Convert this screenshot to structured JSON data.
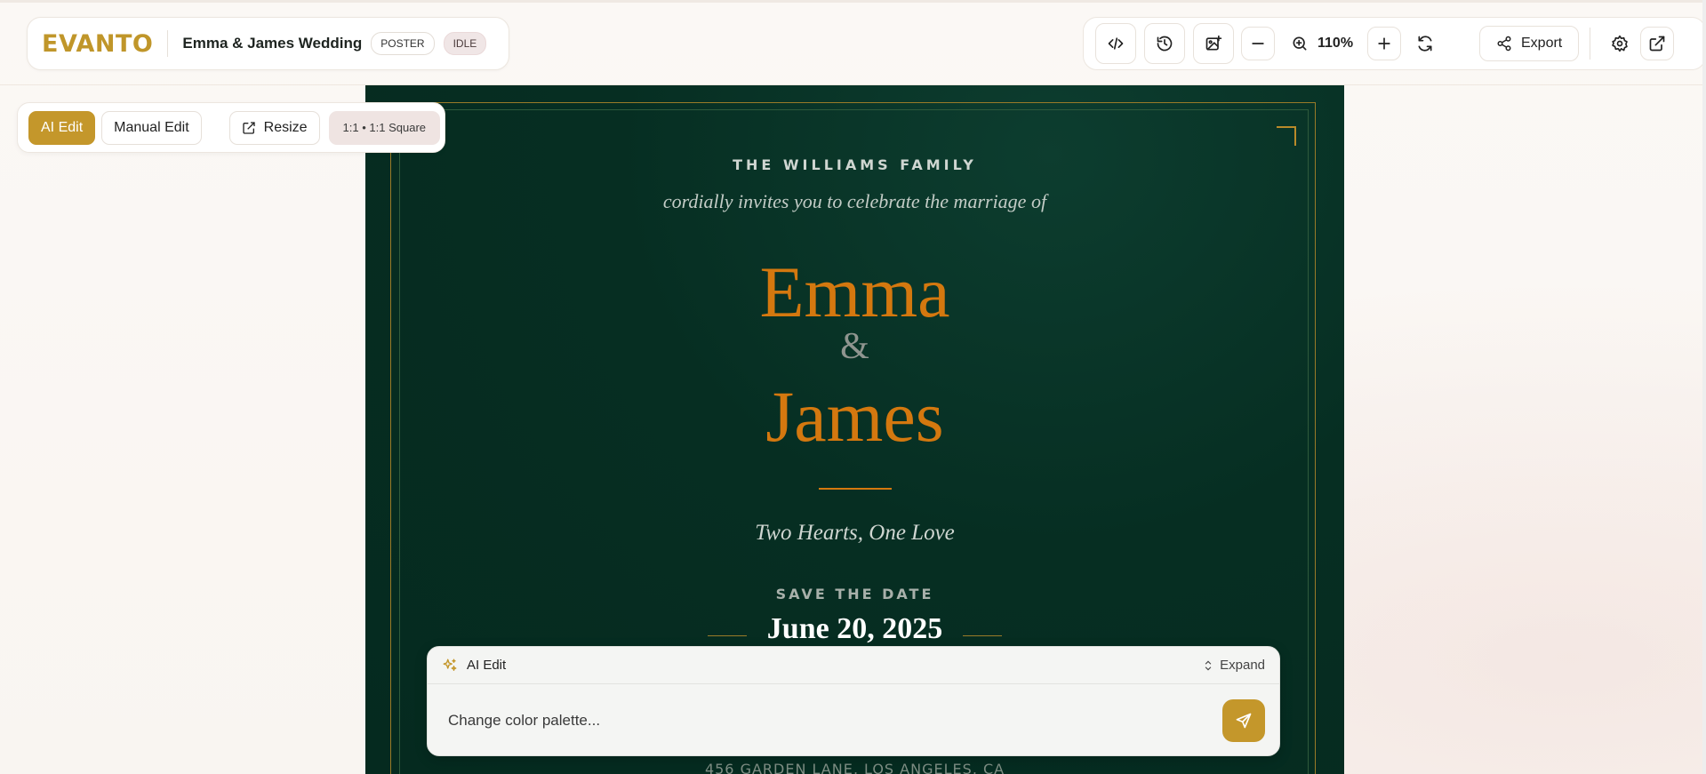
{
  "app": {
    "logo": "EVANTO",
    "project_title": "Emma & James Wedding",
    "type_badge": "POSTER",
    "status_badge": "IDLE"
  },
  "toolbar": {
    "zoom_level": "110%",
    "export_label": "Export",
    "icons": [
      "code-icon",
      "history-icon",
      "image-add-icon",
      "zoom-out-icon",
      "zoom-in-icon",
      "zoom-plus-icon",
      "refresh-icon",
      "share-icon",
      "settings-icon",
      "external-link-icon"
    ]
  },
  "modes": {
    "ai_edit": "AI Edit",
    "manual_edit": "Manual Edit",
    "resize": "Resize",
    "ratio": "1:1 • 1:1 Square"
  },
  "invitation": {
    "family": "THE WILLIAMS FAMILY",
    "invite_line": "cordially invites you to celebrate the marriage of",
    "name1": "Emma",
    "ampersand": "&",
    "name2": "James",
    "tagline": "Two Hearts, One Love",
    "save_the_date": "SAVE THE DATE",
    "date": "June 20, 2025",
    "address": "456 GARDEN LANE, LOS ANGELES, CA"
  },
  "ai_panel": {
    "title": "AI Edit",
    "expand_label": "Expand",
    "input_placeholder": "Change color palette..."
  },
  "colors": {
    "accent": "#c4972b",
    "canvas_bg": "#062e22",
    "name_color": "#d4780f"
  }
}
